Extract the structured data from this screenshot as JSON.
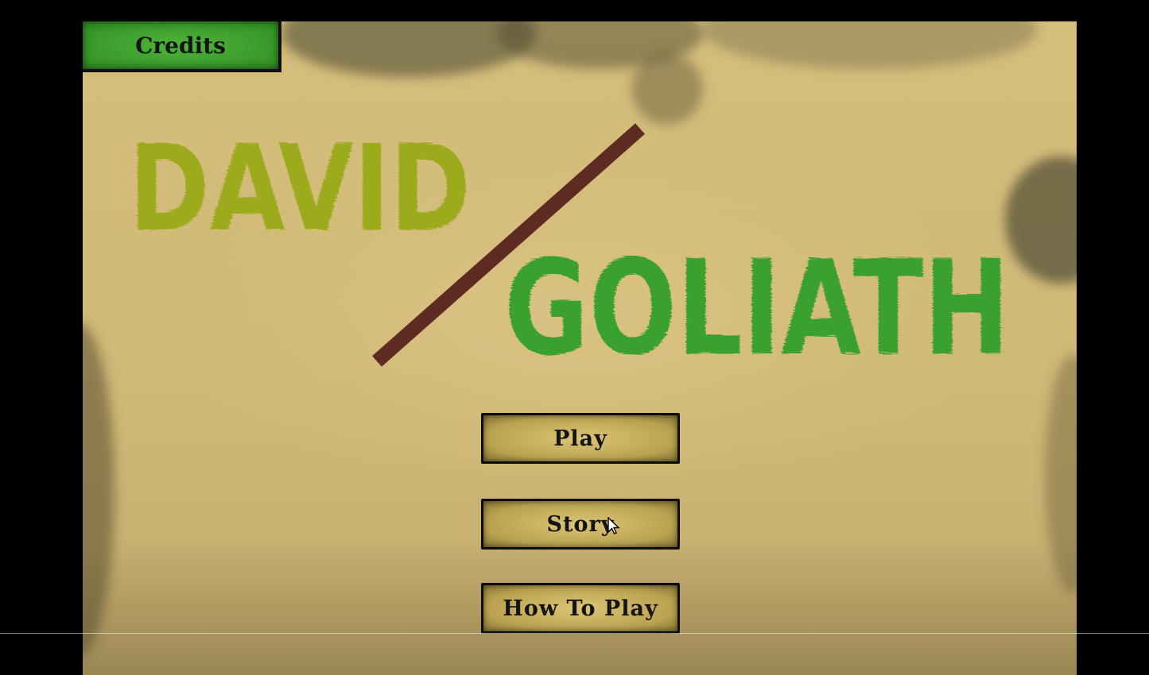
{
  "game": {
    "title_left": "DAVID",
    "title_right": "GOLIATH",
    "colors": {
      "david": "#9cab1c",
      "goliath": "#3ba12f",
      "slash": "#5e2a22",
      "paper": "#d6be7c",
      "credits_bg": "#3fa22e"
    }
  },
  "menu": {
    "credits_label": "Credits",
    "play_label": "Play",
    "story_label": "Story",
    "how_to_play_label": "How To Play"
  },
  "cursor": {
    "icon": "arrow-cursor-icon"
  }
}
